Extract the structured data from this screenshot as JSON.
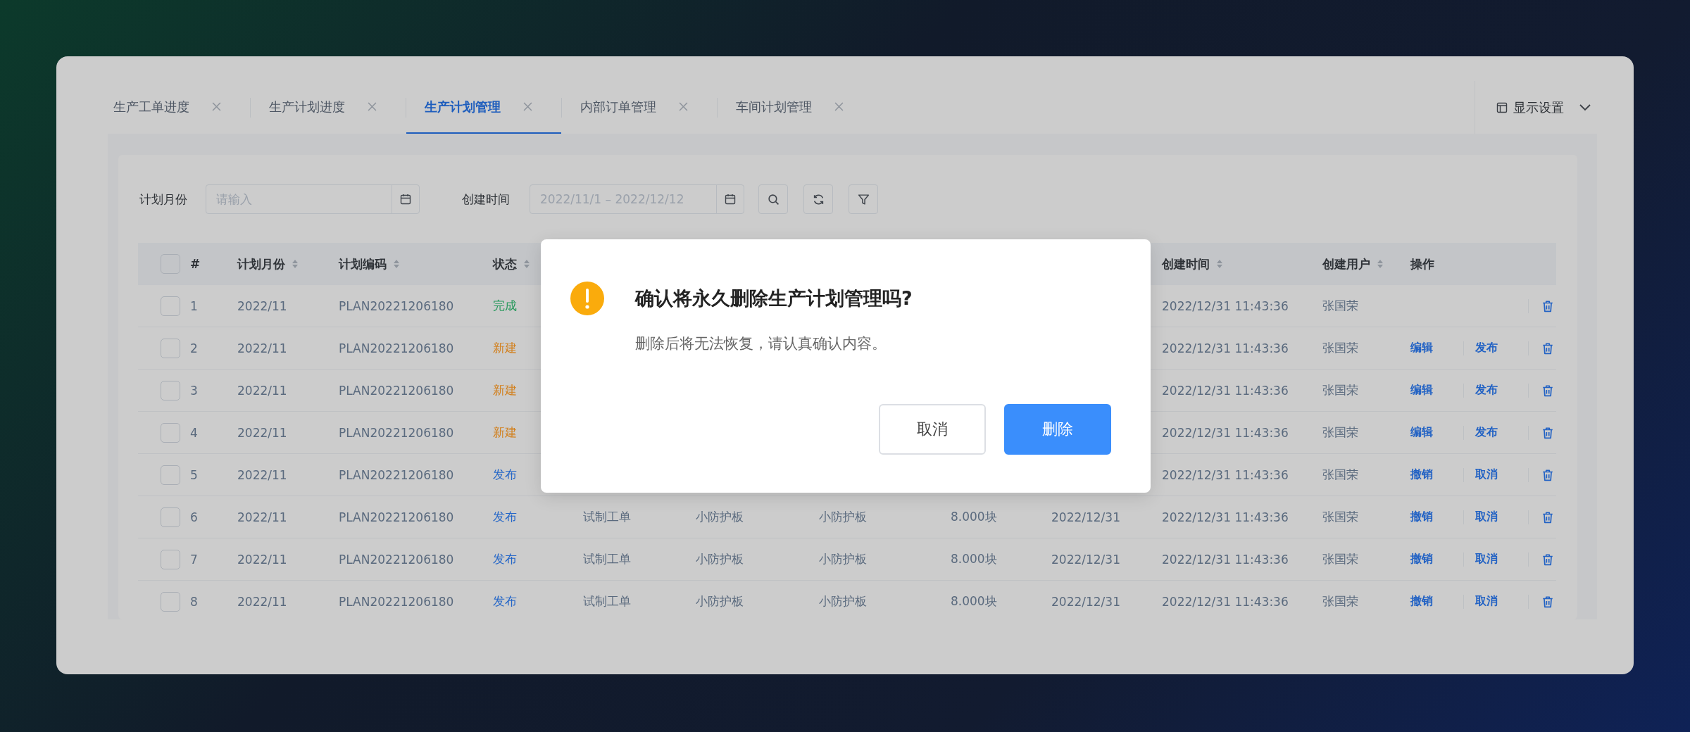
{
  "tabs": [
    {
      "label": "生产工单进度",
      "selected": false
    },
    {
      "label": "生产计划进度",
      "selected": false
    },
    {
      "label": "生产计划管理",
      "selected": true
    },
    {
      "label": "内部订单管理",
      "selected": false
    },
    {
      "label": "车间计划管理",
      "selected": false
    }
  ],
  "display_settings": {
    "label": "显示设置"
  },
  "filters": {
    "plan_month": {
      "label": "计划月份",
      "placeholder": "请输入"
    },
    "created_time": {
      "label": "创建时间",
      "placeholder": "2022/11/1 – 2022/12/12"
    }
  },
  "table": {
    "select_all_checked": false,
    "columns": [
      {
        "label": "#",
        "sortable": false
      },
      {
        "label": "计划月份",
        "sortable": true
      },
      {
        "label": "计划编码",
        "sortable": true
      },
      {
        "label": "状态",
        "sortable": true
      },
      {
        "label": "创建时间",
        "sortable": true
      },
      {
        "label": "创建用户",
        "sortable": true
      },
      {
        "label": "操作",
        "sortable": false
      }
    ],
    "rows": [
      {
        "checked": false,
        "no": "1",
        "plan_month": "2022/11",
        "plan_code": "PLAN20221206180",
        "status": {
          "text": "完成",
          "color": "#27995c"
        },
        "created_time": "2022/12/31 11:43:36",
        "created_user": "张国荣",
        "actions": []
      },
      {
        "checked": false,
        "no": "2",
        "plan_month": "2022/11",
        "plan_code": "PLAN20221206180",
        "status": {
          "text": "新建",
          "color": "#d2801e"
        },
        "created_time": "2022/12/31 11:43:36",
        "created_user": "张国荣",
        "actions": [
          "编辑",
          "发布"
        ]
      },
      {
        "checked": false,
        "no": "3",
        "plan_month": "2022/11",
        "plan_code": "PLAN20221206180",
        "status": {
          "text": "新建",
          "color": "#d2801e"
        },
        "created_time": "2022/12/31 11:43:36",
        "created_user": "张国荣",
        "actions": [
          "编辑",
          "发布"
        ]
      },
      {
        "checked": false,
        "no": "4",
        "plan_month": "2022/11",
        "plan_code": "PLAN20221206180",
        "status": {
          "text": "新建",
          "color": "#d2801e"
        },
        "created_time": "2022/12/31 11:43:36",
        "created_user": "张国荣",
        "actions": [
          "编辑",
          "发布"
        ]
      },
      {
        "checked": false,
        "no": "5",
        "plan_month": "2022/11",
        "plan_code": "PLAN20221206180",
        "status": {
          "text": "发布",
          "color": "#2466c8"
        },
        "created_time": "2022/12/31 11:43:36",
        "created_user": "张国荣",
        "actions": [
          "撤销",
          "取消"
        ]
      },
      {
        "checked": false,
        "no": "6",
        "plan_month": "2022/11",
        "plan_code": "PLAN20221206180",
        "status": {
          "text": "发布",
          "color": "#2466c8"
        },
        "column_5": "试制工单",
        "column_6": "小防护板",
        "column_7": "小防护板",
        "column_8": "8.000块",
        "column_9": "2022/12/31",
        "created_time": "2022/12/31 11:43:36",
        "created_user": "张国荣",
        "actions": [
          "撤销",
          "取消"
        ]
      },
      {
        "checked": false,
        "no": "7",
        "plan_month": "2022/11",
        "plan_code": "PLAN20221206180",
        "status": {
          "text": "发布",
          "color": "#2466c8"
        },
        "column_5": "试制工单",
        "column_6": "小防护板",
        "column_7": "小防护板",
        "column_8": "8.000块",
        "column_9": "2022/12/31",
        "created_time": "2022/12/31 11:43:36",
        "created_user": "张国荣",
        "actions": [
          "撤销",
          "取消"
        ]
      },
      {
        "checked": false,
        "no": "8",
        "plan_month": "2022/11",
        "plan_code": "PLAN20221206180",
        "status": {
          "text": "发布",
          "color": "#2466c8"
        },
        "column_5": "试制工单",
        "column_6": "小防护板",
        "column_7": "小防护板",
        "column_8": "8.000块",
        "column_9": "2022/12/31",
        "created_time": "2022/12/31 11:43:36",
        "created_user": "张国荣",
        "actions": [
          "撤销",
          "取消"
        ]
      }
    ]
  },
  "dialog": {
    "title": "确认将永久删除生产计划管理吗?",
    "message": "删除后将无法恢复，请认真确认内容。",
    "buttons": [
      {
        "label": "取消",
        "kind": "secondary"
      },
      {
        "label": "删除",
        "kind": "primary"
      }
    ]
  }
}
